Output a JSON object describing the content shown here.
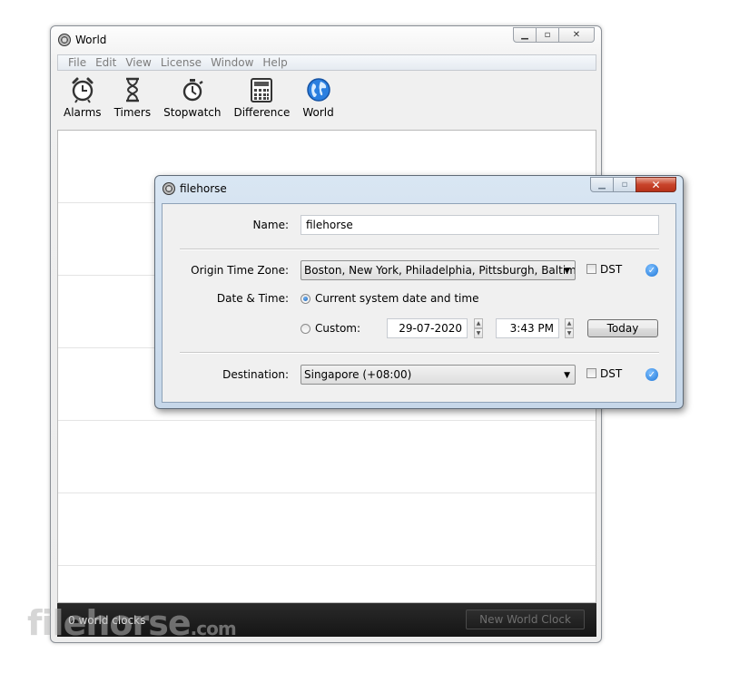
{
  "main_window": {
    "title": "World",
    "menu": [
      "File",
      "Edit",
      "View",
      "License",
      "Window",
      "Help"
    ],
    "toolbar": [
      {
        "label": "Alarms",
        "icon": "alarm-clock-icon"
      },
      {
        "label": "Timers",
        "icon": "hourglass-icon"
      },
      {
        "label": "Stopwatch",
        "icon": "stopwatch-icon"
      },
      {
        "label": "Difference",
        "icon": "calculator-icon"
      },
      {
        "label": "World",
        "icon": "globe-icon"
      }
    ],
    "status": "0 world clocks",
    "new_clock_label": "New World Clock"
  },
  "dialog": {
    "title": "filehorse",
    "name_label": "Name:",
    "name_value": "filehorse",
    "origin_label": "Origin Time Zone:",
    "origin_value": "Boston, New York, Philadelphia, Pittsburgh, Baltimore",
    "dst_label": "DST",
    "datetime_label": "Date & Time:",
    "current_option": "Current system date and time",
    "custom_option": "Custom:",
    "date_value": "29-07-2020",
    "time_value": "3:43 PM",
    "today_label": "Today",
    "destination_label": "Destination:",
    "destination_value": "Singapore (+08:00)"
  },
  "watermark": {
    "text": "filehorse",
    "suffix": ".com"
  },
  "colors": {
    "accent": "#1f77d8",
    "status_bg": "#1d1d1d",
    "close": "#c8432a"
  }
}
